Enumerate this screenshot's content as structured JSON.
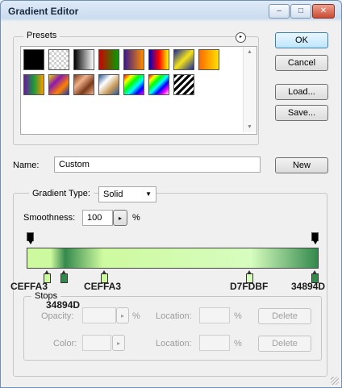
{
  "window": {
    "title": "Gradient Editor",
    "minimize": "‒",
    "maximize": "□",
    "close": "✕"
  },
  "presets": {
    "legend": "Presets",
    "menu_glyph": "▸",
    "scroll_up": "▲",
    "scroll_down": "▼",
    "swatches": [
      {
        "name": "black-swatch",
        "bg": "#000000"
      },
      {
        "name": "transparent-swatch",
        "bg": "repeating-conic-gradient(#cfcfcf 0 25%, #ffffff 0 50%) 0 0/6px 6px"
      },
      {
        "name": "black-white-swatch",
        "bg": "linear-gradient(90deg,#000,#fff)"
      },
      {
        "name": "red-green-swatch",
        "bg": "linear-gradient(90deg,#d10000,#00a000)"
      },
      {
        "name": "violet-orange-swatch",
        "bg": "linear-gradient(90deg,#3a1a8a,#ff8c00)"
      },
      {
        "name": "blue-red-yellow-swatch",
        "bg": "linear-gradient(90deg,#0000c8,#ff0000,#ffff00)"
      },
      {
        "name": "blue-yellow-blue-swatch",
        "bg": "linear-gradient(135deg,#1a2a9a 0%,#f4e21a 50%,#1a2a9a 100%)"
      },
      {
        "name": "orange-yellow-swatch",
        "bg": "linear-gradient(90deg,#ff6a00,#ffe000)"
      },
      {
        "name": "violet-green-orange-swatch",
        "bg": "linear-gradient(90deg,#6a1aa0,#1a9a3a,#ff9a00)"
      },
      {
        "name": "yellow-violet-orange-blue-swatch",
        "bg": "linear-gradient(135deg,#f0d000,#8a1ab0,#ff8000,#1a3ab0)"
      },
      {
        "name": "copper-swatch",
        "bg": "linear-gradient(135deg,#7a3a1a,#f0b08a,#7a3a1a,#f0b08a)"
      },
      {
        "name": "chrome-swatch",
        "bg": "linear-gradient(135deg,#2a5a9a,#ffffff,#c89a5a,#2a5a9a)"
      },
      {
        "name": "spectrum-swatch",
        "bg": "linear-gradient(135deg,#ff0000,#ffff00,#00ff00,#00ffff,#0000ff,#ff00ff)"
      },
      {
        "name": "transparent-rainbow-swatch",
        "bg": "linear-gradient(135deg,#ff0000,#ffff00,#00ff00,#00ffff,#0000ff,#ff00ff,#ffffff)"
      },
      {
        "name": "transparent-stripes-swatch",
        "bg": "repeating-linear-gradient(135deg,#000 0 3px,#ffffff 3px 6px)"
      }
    ]
  },
  "buttons": {
    "ok": "OK",
    "cancel": "Cancel",
    "load": "Load...",
    "save": "Save...",
    "new": "New",
    "delete": "Delete"
  },
  "name": {
    "label": "Name:",
    "value": "Custom"
  },
  "gradient_type": {
    "label": "Gradient Type:",
    "value": "Solid",
    "arrow": "▼"
  },
  "smoothness": {
    "label": "Smoothness:",
    "value": "100",
    "unit": "%",
    "arrow": "▸"
  },
  "stops": {
    "legend": "Stops",
    "opacity_label": "Opacity:",
    "color_label": "Color:",
    "location_label": "Location:",
    "unit": "%",
    "arrow": "▸"
  },
  "color_stops": [
    {
      "name": "stop-1",
      "pos": 0.06,
      "color": "#cefa9f"
    },
    {
      "name": "stop-2",
      "pos": 0.12,
      "color": "#34894d"
    },
    {
      "name": "stop-3",
      "pos": 0.26,
      "color": "#cefa9f"
    },
    {
      "name": "stop-4",
      "pos": 0.77,
      "color": "#d7fdbf"
    },
    {
      "name": "stop-5",
      "pos": 1.0,
      "color": "#34894d"
    }
  ],
  "opacity_stops": [
    {
      "pos": 0.0
    },
    {
      "pos": 1.0
    }
  ],
  "annotations": {
    "a1": "CEFFA3",
    "a2": "34894D",
    "a3": "CEFFA3",
    "a4": "D7FDBF",
    "a5": "34894D"
  }
}
